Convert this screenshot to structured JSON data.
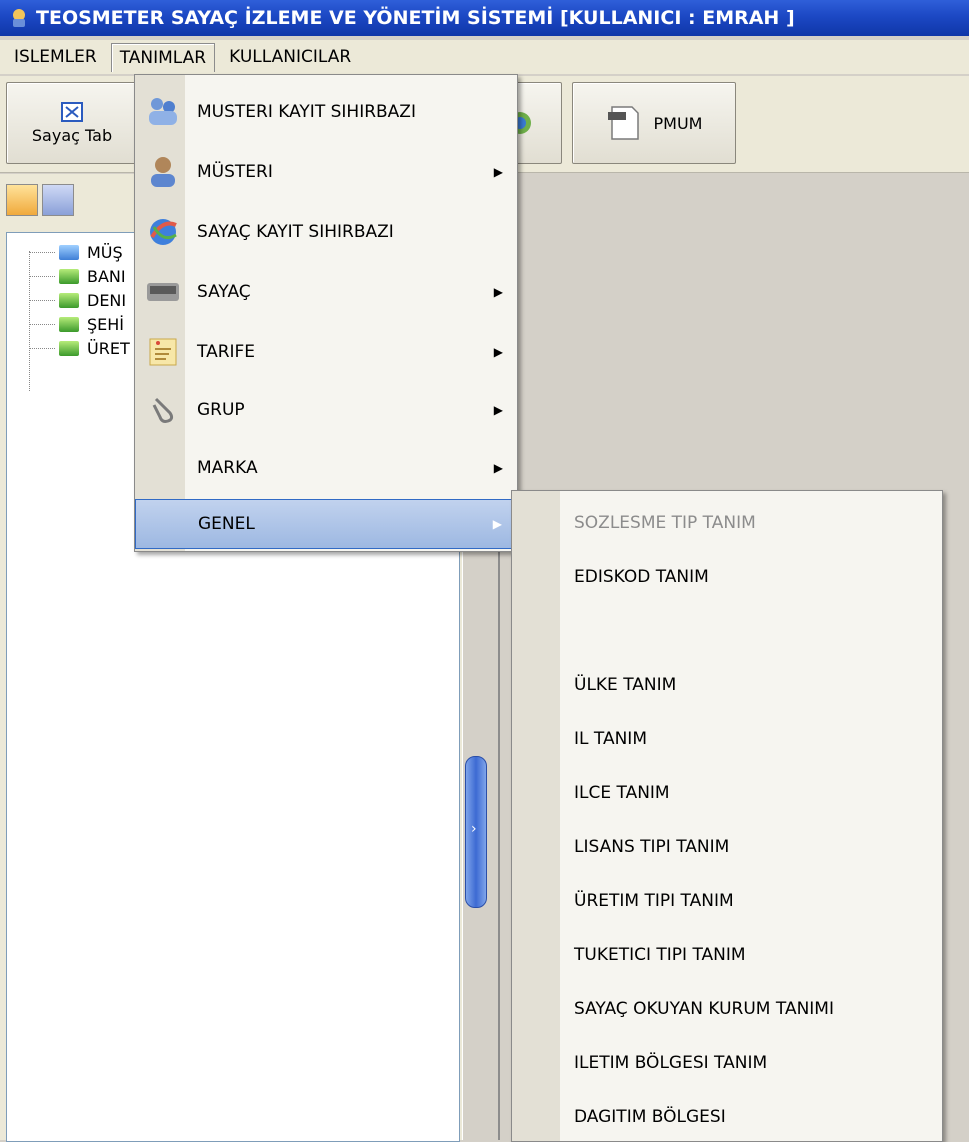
{
  "window": {
    "title": "TEOSMETER SAYAÇ İZLEME VE YÖNETİM SİSTEMİ [KULLANICI : EMRAH ]"
  },
  "menubar": {
    "items": [
      "ISLEMLER",
      "TANIMLAR",
      "KULLANICILAR"
    ],
    "open_item": "TANIMLAR"
  },
  "toolbar": {
    "buttons": [
      {
        "label": "Sayaç Tab",
        "icon": "table-icon"
      },
      {
        "label": "PMUM",
        "icon": "document-icon"
      }
    ]
  },
  "tree": {
    "nodes": [
      {
        "label": "MÜŞ",
        "folder_color": "blue"
      },
      {
        "label": "BANI",
        "folder_color": "green"
      },
      {
        "label": "DENI",
        "folder_color": "green"
      },
      {
        "label": "ŞEHİ",
        "folder_color": "green"
      },
      {
        "label": "ÜRET",
        "folder_color": "green"
      }
    ]
  },
  "menu": {
    "items": [
      {
        "label": "MUSTERI KAYIT SIHIRBAZI",
        "icon": "users-icon",
        "submenu": false
      },
      {
        "label": "MÜSTERI",
        "icon": "person-icon",
        "submenu": true
      },
      {
        "label": "SAYAÇ KAYIT SIHIRBAZI",
        "icon": "globe-icon",
        "submenu": false
      },
      {
        "label": "SAYAÇ",
        "icon": "meter-icon",
        "submenu": true
      },
      {
        "label": "TARIFE",
        "icon": "note-icon",
        "submenu": true
      },
      {
        "label": "GRUP",
        "icon": "paperclip-icon",
        "submenu": true
      },
      {
        "label": "MARKA",
        "icon": "",
        "submenu": true
      },
      {
        "label": "GENEL",
        "icon": "",
        "submenu": true,
        "highlighted": true
      }
    ]
  },
  "submenu": {
    "items": [
      {
        "label": "SOZLESME TIP TANIM",
        "disabled": true
      },
      {
        "label": "EDISKOD TANIM",
        "disabled": false
      },
      {
        "label": "ÜLKE TANIM",
        "disabled": false
      },
      {
        "label": "IL TANIM",
        "disabled": false
      },
      {
        "label": "ILCE TANIM",
        "disabled": false
      },
      {
        "label": "LISANS TIPI TANIM",
        "disabled": false
      },
      {
        "label": "ÜRETIM TIPI TANIM",
        "disabled": false
      },
      {
        "label": "TUKETICI TIPI TANIM",
        "disabled": false
      },
      {
        "label": "SAYAÇ OKUYAN KURUM TANIMI",
        "disabled": false
      },
      {
        "label": "ILETIM BÖLGESI TANIM",
        "disabled": false
      },
      {
        "label": "DAGITIM BÖLGESI",
        "disabled": false
      }
    ]
  },
  "splitter": {
    "grip_glyph": "›"
  },
  "colors": {
    "titlebar": "#1c48c4",
    "highlight": "#9db8e2",
    "highlight_border": "#316ac5",
    "disabled_text": "#8c8c8c"
  }
}
